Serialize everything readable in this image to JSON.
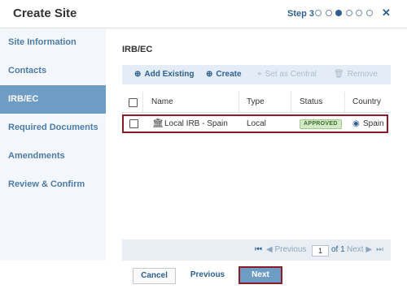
{
  "window": {
    "title": "Create Site",
    "step_label": "Step 3",
    "steps_total": 6,
    "step_current": 3,
    "close_icon": "close-icon"
  },
  "sidebar": {
    "items": [
      {
        "label": "Site Information"
      },
      {
        "label": "Contacts"
      },
      {
        "label": "IRB/EC"
      },
      {
        "label": "Required Documents"
      },
      {
        "label": "Amendments"
      },
      {
        "label": "Review & Confirm"
      }
    ],
    "active_index": 2
  },
  "main": {
    "section_title": "IRB/EC",
    "toolbar": {
      "add_existing": "Add Existing",
      "create": "Create",
      "set_as_central": "Set as Central",
      "remove": "Remove"
    },
    "table": {
      "columns": [
        "Name",
        "Type",
        "Status",
        "Country"
      ],
      "rows": [
        {
          "name": "Local IRB - Spain",
          "type": "Local",
          "status": "APPROVED",
          "country": "Spain",
          "icon": "institution-icon",
          "country_icon": "globe-icon"
        }
      ]
    },
    "pager": {
      "previous": "Previous",
      "page": "1",
      "of": "of 1",
      "next": "Next"
    }
  },
  "footer": {
    "cancel": "Cancel",
    "previous": "Previous",
    "next": "Next"
  },
  "colors": {
    "accent": "#2e5f8f",
    "sidebar_active": "#6f9cc5",
    "highlight_border": "#8b1a2b",
    "approved_bg": "#d3e9c6"
  }
}
